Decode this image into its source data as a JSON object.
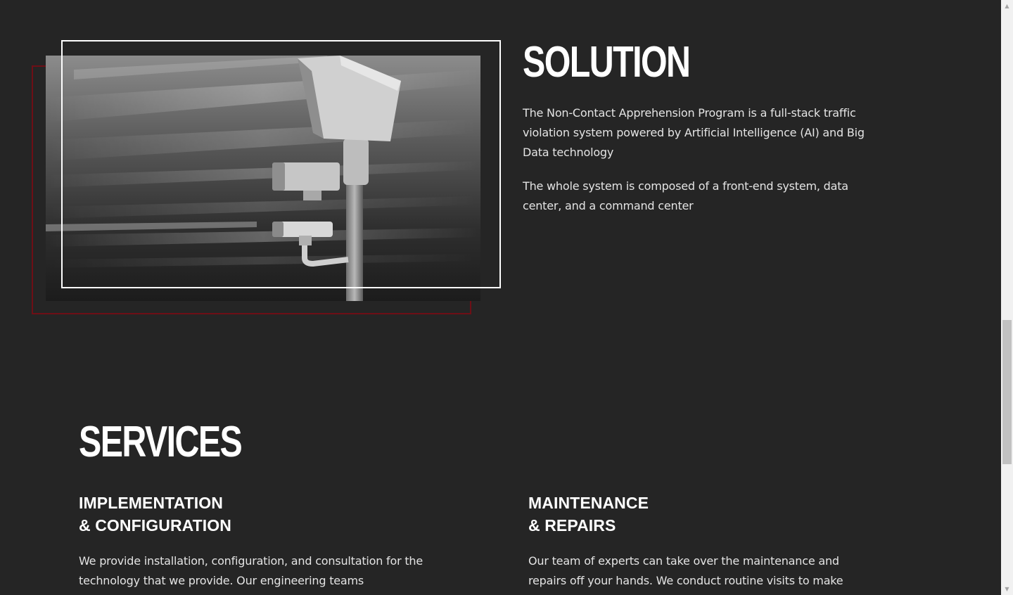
{
  "solution": {
    "title": "SOLUTION",
    "paragraph_1": "The Non-Contact Apprehension Program is a full-stack traffic violation system powered by Artificial Intelligence (AI) and Big Data technology",
    "paragraph_2": "The whole system is composed of a front-end system, data center, and a command center",
    "image_icon": "traffic-camera-photo"
  },
  "services": {
    "title": "SERVICES",
    "items": [
      {
        "title_line_1": "IMPLEMENTATION",
        "title_line_2": "& CONFIGURATION",
        "description": "We provide installation, configuration, and consultation for the technology that we provide. Our engineering teams"
      },
      {
        "title_line_1": "MAINTENANCE",
        "title_line_2": "& REPAIRS",
        "description": "Our team of experts can take over the maintenance and repairs off your hands. We conduct routine visits to make"
      }
    ]
  },
  "colors": {
    "background": "#252525",
    "accent_frame": "#6e0f16",
    "text": "#ffffff"
  },
  "scrollbar": {
    "up_icon": "scroll-up-arrow-icon",
    "down_icon": "scroll-down-arrow-icon"
  }
}
